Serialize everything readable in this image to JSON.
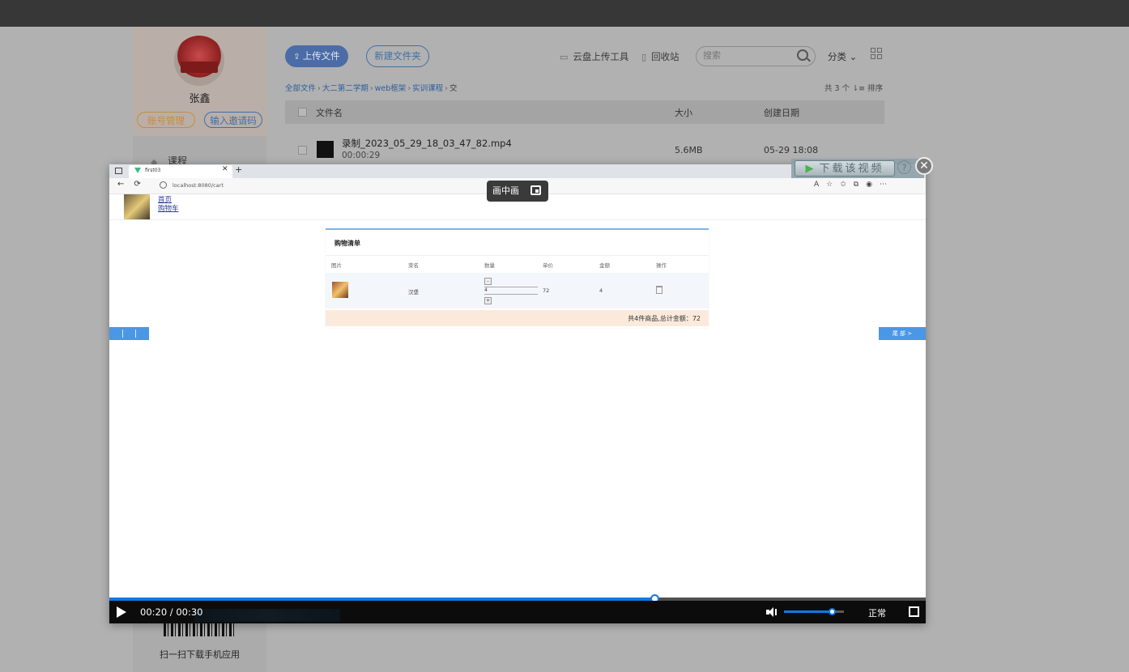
{
  "sidebar": {
    "username": "张鑫",
    "account_btn": "账号管理",
    "invite_btn": "输入邀请码",
    "nav_course": "课程",
    "scan_text": "扫一扫下载手机应用"
  },
  "toolbar": {
    "upload_label": "上传文件",
    "new_folder_label": "新建文件夹",
    "cloud_upload_tool": "云盘上传工具",
    "recycle_bin": "回收站",
    "search_placeholder": "搜索",
    "sort_dropdown": "分类"
  },
  "breadcrumb": [
    "全部文件",
    "大二第二学期",
    "web框架",
    "实训课程",
    "交"
  ],
  "file_count": "共 3 个",
  "sort_label": "排序",
  "table": {
    "headers": [
      "文件名",
      "大小",
      "创建日期"
    ],
    "rows": [
      {
        "name": "录制_2023_05_29_18_03_47_82.mp4",
        "duration": "00:00:29",
        "size": "5.6MB",
        "date": "05-29 18:08"
      }
    ]
  },
  "video": {
    "browser_tab_title": "first03",
    "url": "localhost:8080/cart",
    "page_links": [
      "首页",
      "购物车"
    ],
    "cart": {
      "title": "购物清单",
      "headers": [
        "图片",
        "菜名",
        "数量",
        "单价",
        "金额",
        "操作"
      ],
      "item": {
        "name": "汉堡",
        "qty": "4",
        "price": "72",
        "amount": "4"
      },
      "total": "共4件商品,总计金额：72"
    },
    "side_right_text": "尾 部 >",
    "pip_label": "画中画",
    "download_label": "下载该视频",
    "help_label": "?",
    "close_label": "✕",
    "time_display": "00:20 / 00:30",
    "speed_label": "正常",
    "progress": 0.667,
    "volume": 0.8
  },
  "colors": {
    "accent_blue": "#1279e0",
    "dim_overlay": "#b1b1b1",
    "upload_button": "#4b6ca6"
  },
  "icons": [
    "upload-icon",
    "monitor-icon",
    "trash-icon",
    "search-icon",
    "chevron-down-icon",
    "grid-view-icon",
    "sort-icon",
    "play-icon",
    "volume-icon",
    "fullscreen-icon",
    "close-icon",
    "pip-icon"
  ]
}
